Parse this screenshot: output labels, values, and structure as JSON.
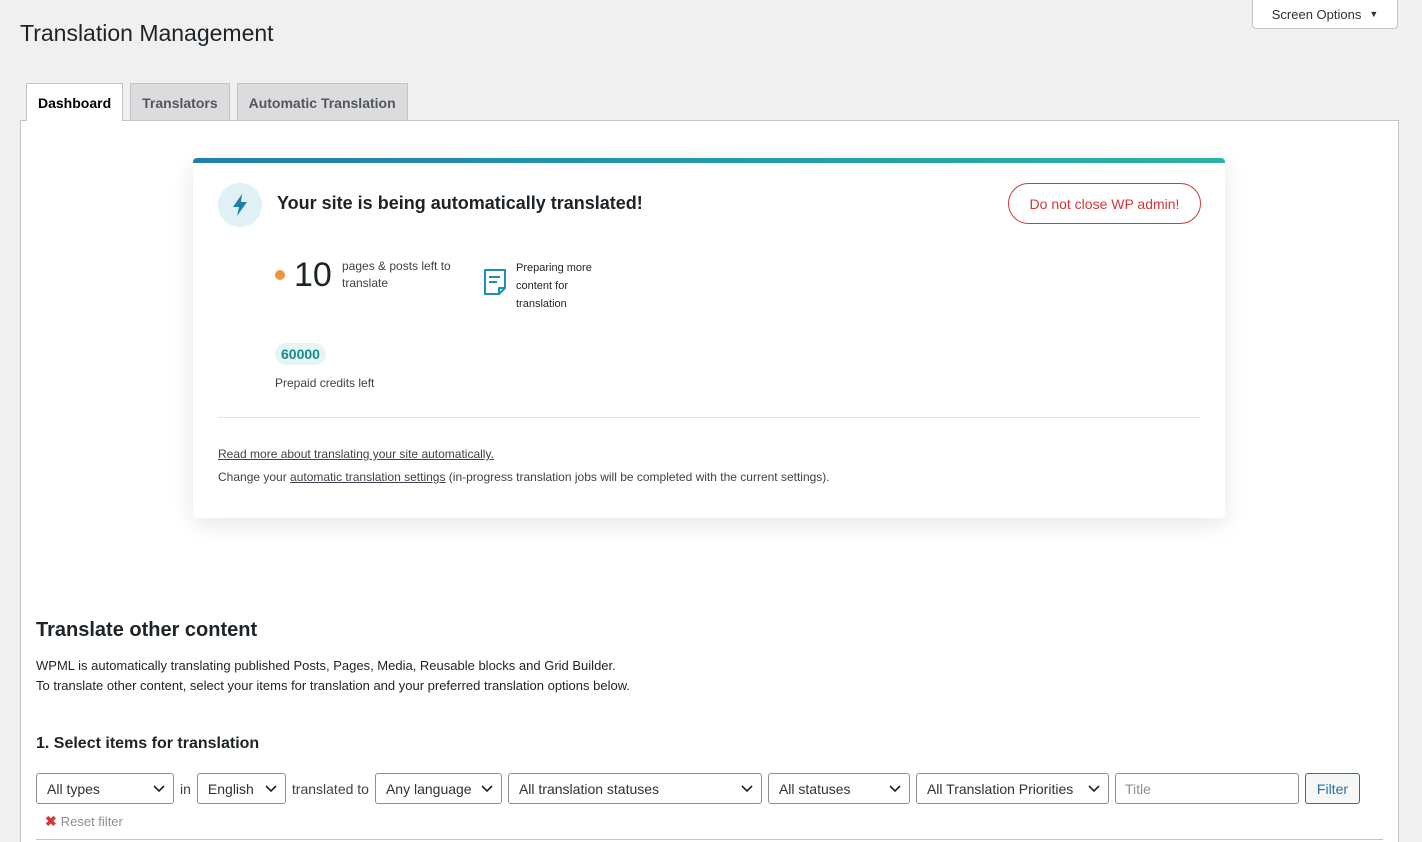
{
  "page": {
    "title": "Translation Management"
  },
  "screen_options": {
    "label": "Screen Options",
    "arrow": "▼"
  },
  "tabs": [
    {
      "label": "Dashboard",
      "active": true
    },
    {
      "label": "Translators",
      "active": false
    },
    {
      "label": "Automatic Translation",
      "active": false
    }
  ],
  "card": {
    "title": "Your site is being automatically translated!",
    "warning_button": "Do not close WP admin!",
    "count": "10",
    "count_label": "pages & posts left to translate",
    "preparing_label": "Preparing more content for translation",
    "credits": "60000",
    "credits_label": "Prepaid credits left",
    "read_more_link": "Read more about translating your site automatically.",
    "change_prefix": "Change your ",
    "change_link": "automatic translation settings",
    "change_suffix": " (in-progress translation jobs will be completed with the current settings).",
    "colors": {
      "accent_start": "#1f7fa8",
      "accent_end": "#2ab3a6",
      "warning": "#d63638",
      "dot": "#f0953a",
      "badge": "#1a8a86"
    },
    "icons": [
      "bolt-icon",
      "document-icon"
    ]
  },
  "other_content": {
    "title": "Translate other content",
    "line1": "WPML is automatically translating published Posts, Pages, Media, Reusable blocks and Grid Builder.",
    "line2": "To translate other content, select your items for translation and your preferred translation options below."
  },
  "select_items": {
    "title": "1. Select items for translation",
    "type_select": "All types",
    "in_label": "in",
    "language_select": "English",
    "translated_to_label": "translated to",
    "target_select": "Any language",
    "status_select": "All translation statuses",
    "post_status_select": "All statuses",
    "priority_select": "All Translation Priorities",
    "title_placeholder": "Title",
    "filter_button": "Filter",
    "reset_filter": "Reset filter",
    "reset_icon": "✖"
  }
}
